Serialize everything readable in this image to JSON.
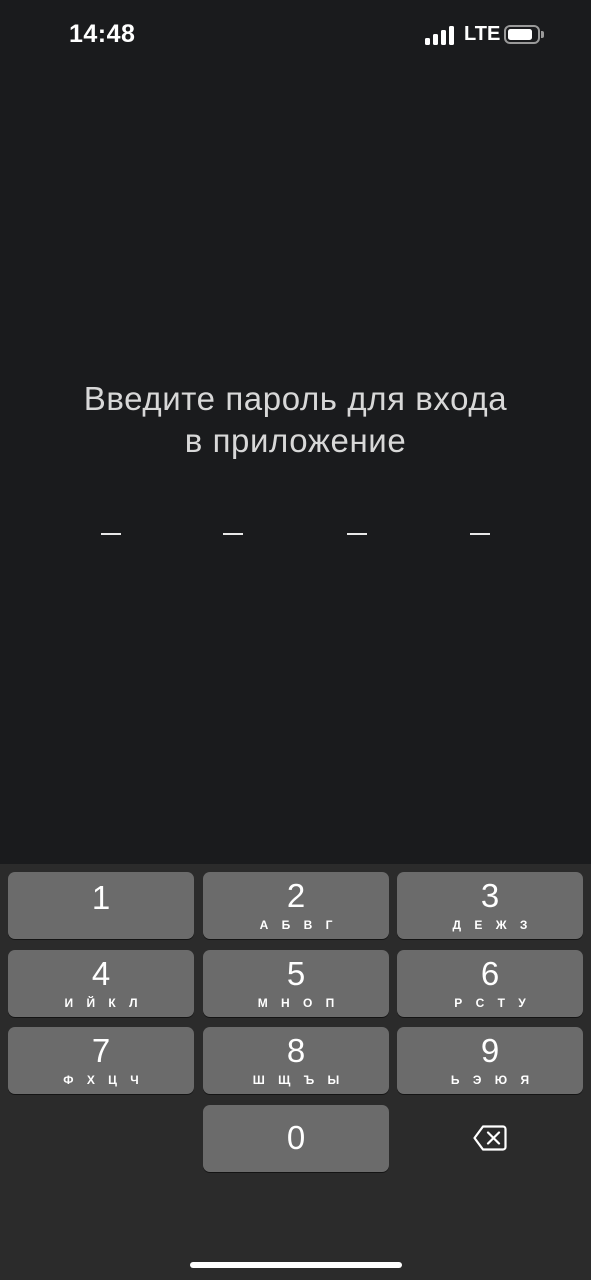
{
  "status_bar": {
    "time": "14:48",
    "network": "LTE",
    "signal_bars_active": 4,
    "battery_level_percent": 85
  },
  "prompt": {
    "line1": "Введите пароль для входа",
    "line2": "в приложение"
  },
  "pin": {
    "length": 4,
    "entered": 0
  },
  "keypad": {
    "keys": [
      {
        "digit": "1",
        "letters": ""
      },
      {
        "digit": "2",
        "letters": "А Б В Г"
      },
      {
        "digit": "3",
        "letters": "Д Е Ж З"
      },
      {
        "digit": "4",
        "letters": "И Й К Л"
      },
      {
        "digit": "5",
        "letters": "М Н О П"
      },
      {
        "digit": "6",
        "letters": "Р С Т У"
      },
      {
        "digit": "7",
        "letters": "Ф Х Ц Ч"
      },
      {
        "digit": "8",
        "letters": "Ш Щ Ъ Ы"
      },
      {
        "digit": "9",
        "letters": "Ь Э Ю Я"
      },
      {
        "digit": "0",
        "letters": ""
      }
    ],
    "delete_icon": "backspace-icon"
  },
  "colors": {
    "background": "#1a1b1d",
    "keypad_background": "#2b2b2b",
    "key_background": "#6b6b6b",
    "text": "#ffffff"
  }
}
